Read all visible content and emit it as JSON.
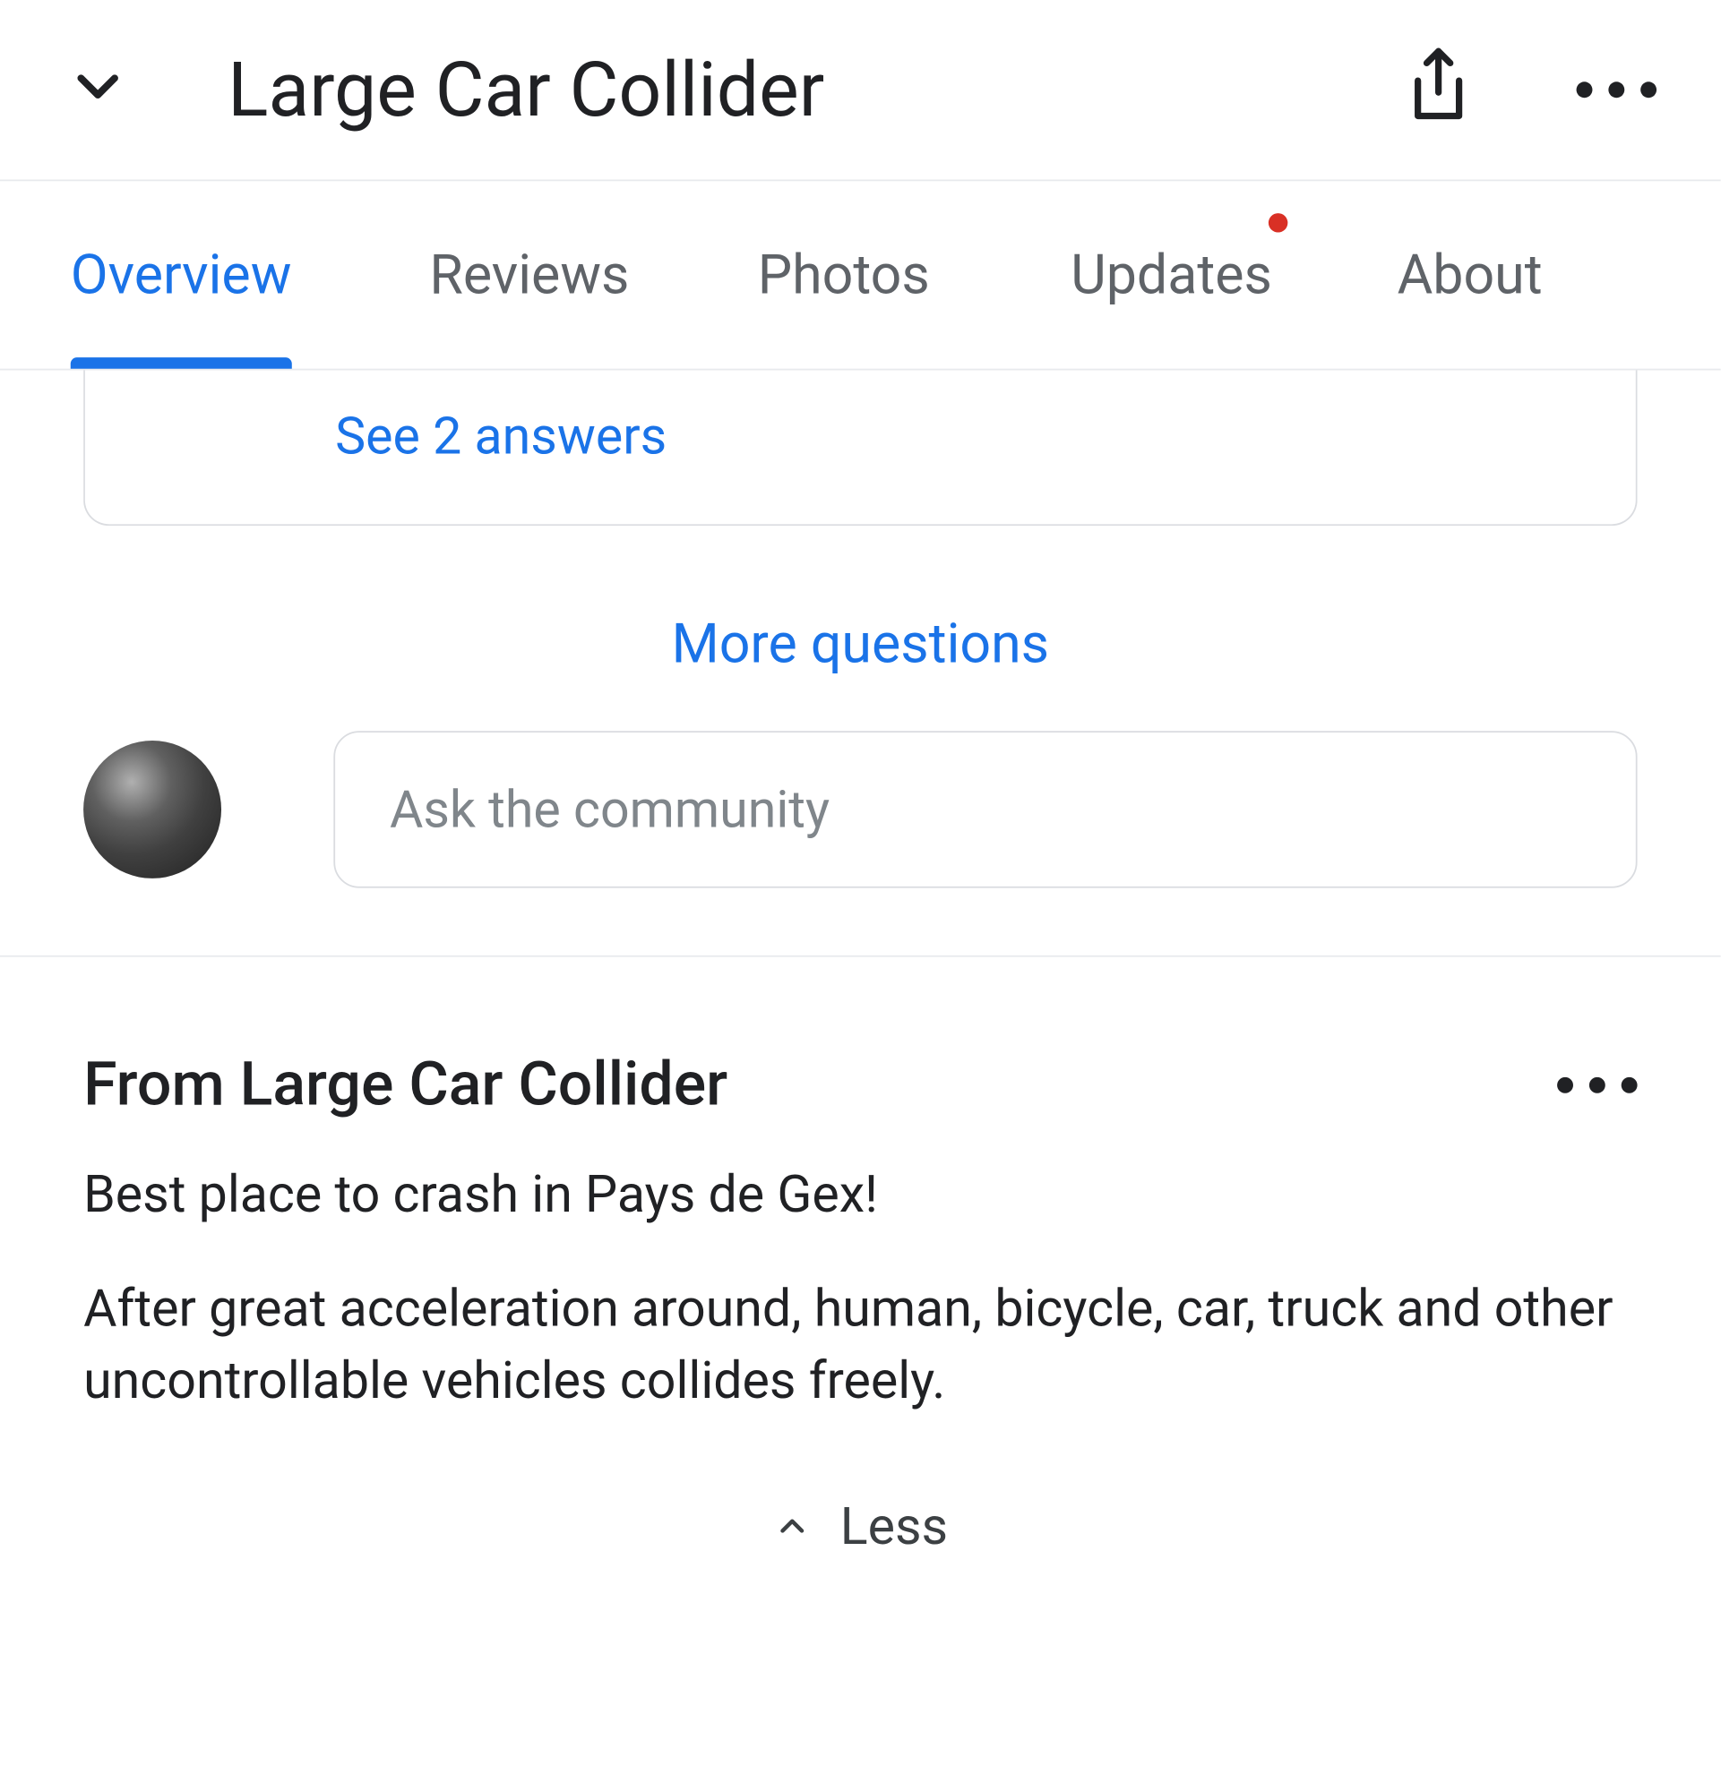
{
  "header": {
    "title": "Large Car Collider"
  },
  "tabs": {
    "items": [
      {
        "label": "Overview",
        "active": true,
        "badge": false
      },
      {
        "label": "Reviews",
        "active": false,
        "badge": false
      },
      {
        "label": "Photos",
        "active": false,
        "badge": false
      },
      {
        "label": "Updates",
        "active": false,
        "badge": true
      },
      {
        "label": "About",
        "active": false,
        "badge": false
      }
    ]
  },
  "qa": {
    "see_answers": "See 2 answers",
    "more_questions": "More questions"
  },
  "ask": {
    "placeholder": "Ask the community"
  },
  "from": {
    "title": "From Large Car Collider",
    "para1": "Best place to crash in Pays de Gex!",
    "para2": "After great acceleration around, human, bicycle, car, truck and other uncontrollable vehicles collides freely.",
    "less": "Less"
  }
}
